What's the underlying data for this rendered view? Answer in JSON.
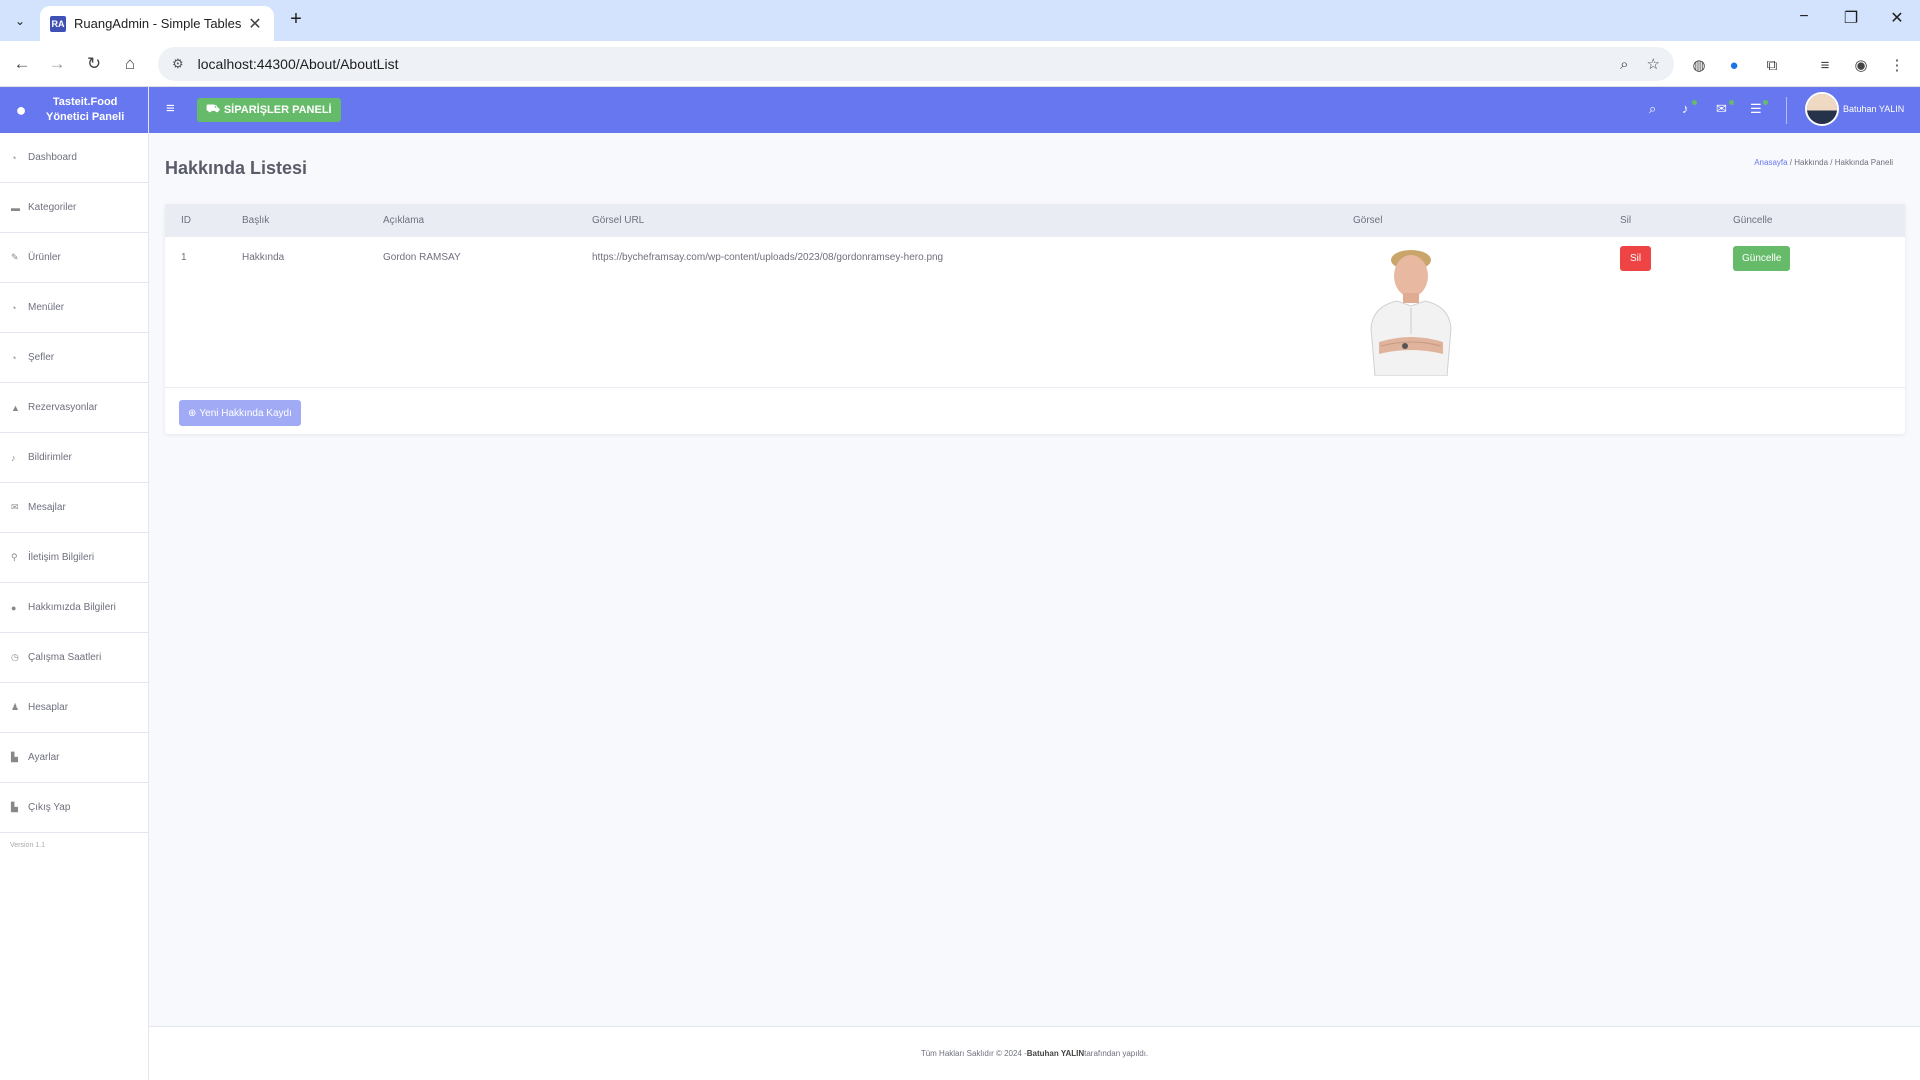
{
  "browser": {
    "tab_title": "RuangAdmin - Simple Tables",
    "favicon_text": "RA",
    "url": "localhost:44300/About/AboutList"
  },
  "sidebar": {
    "brand_line1": "Tasteit.Food",
    "brand_line2": "Yönetici Paneli",
    "items": [
      {
        "label": "Dashboard",
        "icon": "dashboard-icon"
      },
      {
        "label": "Kategoriler",
        "icon": "folder-icon"
      },
      {
        "label": "Ürünler",
        "icon": "edit-icon"
      },
      {
        "label": "Menüler",
        "icon": "menu-icon"
      },
      {
        "label": "Şefler",
        "icon": "chef-icon"
      },
      {
        "label": "Rezervasyonlar",
        "icon": "calendar-icon"
      },
      {
        "label": "Bildirimler",
        "icon": "bell-icon"
      },
      {
        "label": "Mesajlar",
        "icon": "envelope-icon"
      },
      {
        "label": "İletişim Bilgileri",
        "icon": "location-icon"
      },
      {
        "label": "Hakkımızda Bilgileri",
        "icon": "info-icon"
      },
      {
        "label": "Çalışma Saatleri",
        "icon": "clock-icon"
      },
      {
        "label": "Hesaplar",
        "icon": "user-icon"
      },
      {
        "label": "Ayarlar",
        "icon": "chart-icon"
      },
      {
        "label": "Çıkış Yap",
        "icon": "chart-icon"
      }
    ],
    "version": "Version 1.1"
  },
  "topbar": {
    "orders_button": "SİPARİŞLER PANELİ",
    "user_name": "Batuhan YALIN"
  },
  "page": {
    "title": "Hakkında Listesi",
    "breadcrumb": {
      "home": "Anasayfa",
      "section": "Hakkında",
      "current": "Hakkında Paneli"
    }
  },
  "table": {
    "headers": {
      "id": "ID",
      "baslik": "Başlık",
      "aciklama": "Açıklama",
      "url": "Görsel URL",
      "gorsel": "Görsel",
      "sil": "Sil",
      "guncelle": "Güncelle"
    },
    "rows": [
      {
        "id": "1",
        "baslik": "Hakkında",
        "aciklama": "Gordon RAMSAY",
        "url": "https://bycheframsay.com/wp-content/uploads/2023/08/gordonramsey-hero.png",
        "delete_label": "Sil",
        "update_label": "Güncelle"
      }
    ],
    "new_button": "Yeni Hakkında Kaydı"
  },
  "footer": {
    "prefix": "Tüm Hakları Saklıdır © 2024 - ",
    "author": "Batuhan YALIN",
    "suffix": " tarafından yapıldı."
  },
  "colors": {
    "primary": "#6777ef",
    "success": "#66bb6a",
    "danger": "#ef4444"
  }
}
